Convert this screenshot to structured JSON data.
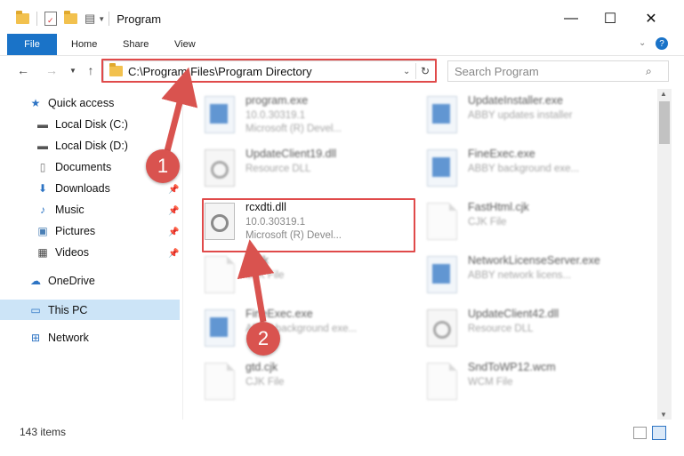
{
  "window": {
    "title": "Program",
    "minimize": "—",
    "maximize": "☐",
    "close": "✕"
  },
  "ribbon": {
    "file": "File",
    "home": "Home",
    "share": "Share",
    "view": "View",
    "help": "?"
  },
  "address": {
    "path": "C:\\Program Files\\Program Directory"
  },
  "search": {
    "placeholder": "Search Program"
  },
  "sidebar": {
    "quick_access": "Quick access",
    "local_c": "Local Disk (C:)",
    "local_d": "Local Disk (D:)",
    "documents": "Documents",
    "downloads": "Downloads",
    "music": "Music",
    "pictures": "Pictures",
    "videos": "Videos",
    "onedrive": "OneDrive",
    "this_pc": "This PC",
    "network": "Network"
  },
  "files": {
    "f1": {
      "name": "program.exe",
      "l2": "10.0.30319.1",
      "l3": "Microsoft (R) Devel..."
    },
    "f2": {
      "name": "UpdateInstaller.exe",
      "l2": "ABBY updates installer",
      "l3": ""
    },
    "f3": {
      "name": "UpdateClient19.dll",
      "l2": "Resource DLL",
      "l3": ""
    },
    "f4": {
      "name": "FineExec.exe",
      "l2": "ABBY background exe...",
      "l3": ""
    },
    "f5": {
      "name": "rcxdti.dll",
      "l2": "10.0.30319.1",
      "l3": "Microsoft (R) Devel..."
    },
    "f6": {
      "name": "FastHtml.cjk",
      "l2": "CJK File",
      "l3": ""
    },
    "f7": {
      "name": "...cjk",
      "l2": "CJK File",
      "l3": ""
    },
    "f8": {
      "name": "NetworkLicenseServer.exe",
      "l2": "ABBY network licens...",
      "l3": ""
    },
    "f9": {
      "name": "FineExec.exe",
      "l2": "ABBY background exe...",
      "l3": ""
    },
    "f10": {
      "name": "UpdateClient42.dll",
      "l2": "Resource DLL",
      "l3": ""
    },
    "f11": {
      "name": "gtd.cjk",
      "l2": "CJK File",
      "l3": ""
    },
    "f12": {
      "name": "SndToWP12.wcm",
      "l2": "WCM File",
      "l3": ""
    }
  },
  "status": {
    "count": "143 items"
  },
  "callouts": {
    "one": "1",
    "two": "2"
  },
  "colors": {
    "accent": "#1a73c8",
    "callout": "#d9534f",
    "selection": "#cce4f7"
  }
}
